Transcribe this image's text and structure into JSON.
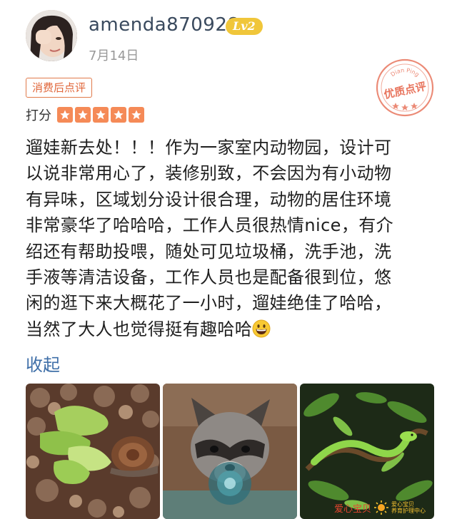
{
  "header": {
    "username": "amenda870928",
    "level_badge": "Lv2",
    "date": "7月14日"
  },
  "review_tag": "消费后点评",
  "quality_stamp": {
    "top_text": "Dian Ping",
    "main_text": "优质点评"
  },
  "rating": {
    "label": "打分",
    "stars": 5
  },
  "content": {
    "lines": [
      "遛娃新去处！！！作为一家室内动物园，设计可",
      "以说非常用心了，装修别致，不会因为有小动物",
      "有异味，区域划分设计很合理，动物的居住环境",
      "非常豪华了哈哈哈，工作人员很热情nice，有介",
      "绍还有帮助投喂，随处可见垃圾桶，洗手池，洗",
      "手液等清洁设备，工作人员也是配备很到位，悠",
      "闲的逛下来大概花了一小时，遛娃绝佳了哈哈，",
      "当然了大人也觉得挺有趣哈哈"
    ],
    "emoji": "grinning-face"
  },
  "collapse_label": "收起",
  "photos": [
    {
      "subject": "snail-on-lettuce"
    },
    {
      "subject": "raccoon-behind-glass"
    },
    {
      "subject": "green-snake-on-branch"
    }
  ],
  "watermark": {
    "brand": "爱心宝贝",
    "small_top": "爱心宝贝",
    "small_bottom": "养育护理中心"
  },
  "colors": {
    "username": "#3a4a5e",
    "level_badge": "#f0c63a",
    "tag_border": "#e07a4a",
    "stars": "#f58a57",
    "link": "#3f6fa8",
    "stamp": "#e8755e"
  }
}
